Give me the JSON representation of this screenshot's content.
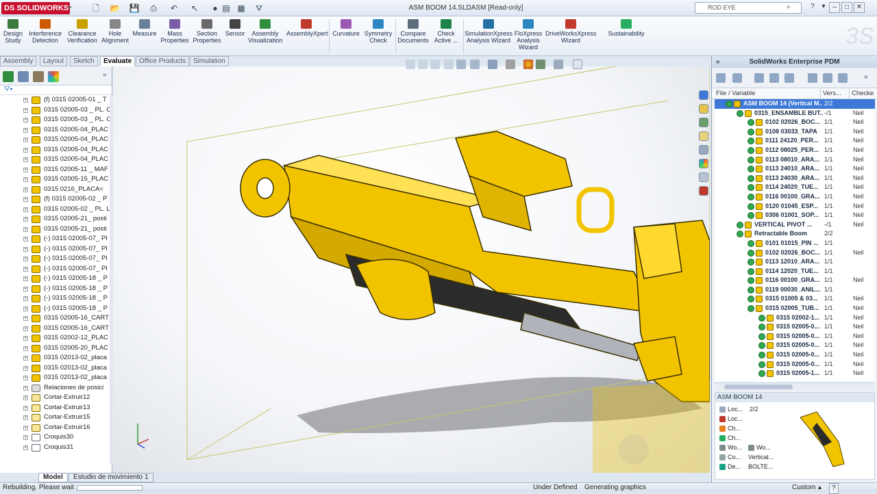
{
  "app": {
    "logo_text": "DS SOLIDWORKS",
    "document_title": "ASM BOOM 14.SLDASM [Read-only]"
  },
  "search": {
    "value": "ROD EYE"
  },
  "window_controls": [
    "?",
    "▾",
    "–",
    "□",
    "✕"
  ],
  "command_manager": {
    "items": [
      {
        "label": "Design\nStudy",
        "color": "#3a7a3a"
      },
      {
        "label": "Interference\nDetection",
        "color": "#d05a00"
      },
      {
        "label": "Clearance\nVerification",
        "color": "#c8a000"
      },
      {
        "label": "Hole\nAlignment",
        "color": "#888888"
      },
      {
        "label": "Measure",
        "color": "#6a7f99"
      },
      {
        "label": "Mass\nProperties",
        "color": "#7b5ea8"
      },
      {
        "label": "Section\nProperties",
        "color": "#6a6a6a"
      },
      {
        "label": "Sensor",
        "color": "#444444"
      },
      {
        "label": "Assembly\nVisualization",
        "color": "#2f8f3f"
      },
      {
        "label": "AssemblyXpert",
        "color": "#c0392b"
      },
      {
        "label": "Curvature",
        "color": "#9b59b6"
      },
      {
        "label": "Symmetry\nCheck",
        "color": "#2e86c1"
      },
      {
        "label": "Compare\nDocuments",
        "color": "#5d6d7e"
      },
      {
        "label": "Check\nActive ...",
        "color": "#1e8449"
      },
      {
        "label": "SimulationXpress\nAnalysis Wizard",
        "color": "#2471a3"
      },
      {
        "label": "FloXpress\nAnalysis\nWizard",
        "color": "#2e86c1"
      },
      {
        "label": "DriveWorksXpress\nWizard",
        "color": "#c0392b"
      },
      {
        "label": "Sustainability",
        "color": "#27ae60"
      }
    ]
  },
  "tabs": [
    {
      "label": "Assembly",
      "active": false
    },
    {
      "label": "Layout",
      "active": false
    },
    {
      "label": "Sketch",
      "active": false
    },
    {
      "label": "Evaluate",
      "active": true
    },
    {
      "label": "Office Products",
      "active": false
    },
    {
      "label": "Simulation",
      "active": false
    }
  ],
  "feature_tree": [
    {
      "label": "(f) 0315 02005-01 _ T",
      "type": "part"
    },
    {
      "label": "0315 02005-03 _ PL. C",
      "type": "part"
    },
    {
      "label": "0315 02005-03 _ PL. C",
      "type": "part"
    },
    {
      "label": "0315 02005-04_PLAC",
      "type": "part"
    },
    {
      "label": "0315 02005-04_PLAC",
      "type": "part"
    },
    {
      "label": "0315 02005-04_PLAC",
      "type": "part"
    },
    {
      "label": "0315 02005-04_PLAC",
      "type": "part"
    },
    {
      "label": "0315 02005-11 _ MAF",
      "type": "part"
    },
    {
      "label": "0315 02005-15_PLAC",
      "type": "part"
    },
    {
      "label": "0315 0216_PLACA<",
      "type": "part"
    },
    {
      "label": "(f) 0315 02005-02 _ P",
      "type": "part"
    },
    {
      "label": "0315 02005-02 _ PL. L",
      "type": "part"
    },
    {
      "label": "0315 02005-21_ posti",
      "type": "part"
    },
    {
      "label": "0315 02005-21_ posti",
      "type": "part"
    },
    {
      "label": "(-) 0315 02005-07_ PI",
      "type": "part"
    },
    {
      "label": "(-) 0315 02005-07_ PI",
      "type": "part"
    },
    {
      "label": "(-) 0315 02005-07_ PI",
      "type": "part"
    },
    {
      "label": "(-) 0315 02005-07_ PI",
      "type": "part"
    },
    {
      "label": "(-) 0315 02005-18 _ P",
      "type": "part"
    },
    {
      "label": "(-) 0315 02005-18 _ P",
      "type": "part"
    },
    {
      "label": "(-) 0315 02005-18 _ P",
      "type": "part"
    },
    {
      "label": "(-) 0315 02005-18 _ P",
      "type": "part"
    },
    {
      "label": "0315 02005-16_CART",
      "type": "part"
    },
    {
      "label": "0315 02005-16_CART",
      "type": "part"
    },
    {
      "label": "0315 02002-12_PLAC",
      "type": "part"
    },
    {
      "label": "0315 02005-20_PLAC",
      "type": "part"
    },
    {
      "label": "0315 02013-02_placa",
      "type": "part"
    },
    {
      "label": "0315 02013-02_placa",
      "type": "part"
    },
    {
      "label": "0315 02013-02_placa",
      "type": "part"
    },
    {
      "label": "Relaciones de posici",
      "type": "rel"
    },
    {
      "label": "Cortar-Extruir12",
      "type": "feat"
    },
    {
      "label": "Cortar-Extruir13",
      "type": "feat"
    },
    {
      "label": "Cortar-Extruir15",
      "type": "feat"
    },
    {
      "label": "Cortar-Extruir16",
      "type": "feat"
    },
    {
      "label": "Croquis30",
      "type": "sk"
    },
    {
      "label": "Croquis31",
      "type": "sk"
    }
  ],
  "bottom_tabs": [
    {
      "label": "Model",
      "active": true
    },
    {
      "label": "Estudio de movimiento 1",
      "active": false
    }
  ],
  "pdm": {
    "title": "SolidWorks Enterprise PDM",
    "columns": {
      "file": "File / Variable",
      "version": "Vers...",
      "checked": "Checke"
    },
    "rows": [
      {
        "name": "ASM BOOM 14  (Vertical M...",
        "version": "2/2",
        "checked": "",
        "level": 0,
        "selected": true
      },
      {
        "name": "0315_ENSAMBLE BUT...",
        "version": "-/1",
        "checked": "Neil",
        "level": 1
      },
      {
        "name": "0102 02026_BOC...",
        "version": "1/1",
        "checked": "Neil",
        "level": 2
      },
      {
        "name": "0108 03033_TAPA",
        "version": "1/1",
        "checked": "Neil",
        "level": 2
      },
      {
        "name": "0111 24120_PER...",
        "version": "1/1",
        "checked": "Neil",
        "level": 2
      },
      {
        "name": "0112 08025_PER...",
        "version": "1/1",
        "checked": "Neil",
        "level": 2
      },
      {
        "name": "0113 08010_ARA...",
        "version": "1/1",
        "checked": "Neil",
        "level": 2
      },
      {
        "name": "0113 24010_ARA...",
        "version": "1/1",
        "checked": "Neil",
        "level": 2
      },
      {
        "name": "0113 24030_ARA...",
        "version": "1/1",
        "checked": "Neil",
        "level": 2
      },
      {
        "name": "0114 24020_TUE...",
        "version": "1/1",
        "checked": "Neil",
        "level": 2
      },
      {
        "name": "0116 00100_GRA...",
        "version": "1/1",
        "checked": "Neil",
        "level": 2
      },
      {
        "name": "0120 01045_ESP...",
        "version": "1/1",
        "checked": "Neil",
        "level": 2
      },
      {
        "name": "0306 01001_SOP...",
        "version": "1/1",
        "checked": "Neil",
        "level": 2
      },
      {
        "name": "VERTICAL PIVOT ...",
        "version": "-/1",
        "checked": "Neil",
        "level": 1
      },
      {
        "name": "Retractable Boom",
        "version": "2/2",
        "checked": "",
        "level": 1
      },
      {
        "name": "0101 01015_PIN ...",
        "version": "1/1",
        "checked": "",
        "level": 2
      },
      {
        "name": "0102 02026_BOC...",
        "version": "1/1",
        "checked": "Neil",
        "level": 2
      },
      {
        "name": "0113 12010_ARA...",
        "version": "1/1",
        "checked": "",
        "level": 2
      },
      {
        "name": "0114 12020_TUE...",
        "version": "1/1",
        "checked": "",
        "level": 2
      },
      {
        "name": "0116 00100_GRA...",
        "version": "1/1",
        "checked": "Neil",
        "level": 2
      },
      {
        "name": "0119 00030_ANIL...",
        "version": "1/1",
        "checked": "",
        "level": 2
      },
      {
        "name": "0315 01005 & 03...",
        "version": "1/1",
        "checked": "Neil",
        "level": 2
      },
      {
        "name": "0315 02005_TUB...",
        "version": "1/1",
        "checked": "Neil",
        "level": 2
      },
      {
        "name": "0315 02002-1...",
        "version": "1/1",
        "checked": "Neil",
        "level": 3
      },
      {
        "name": "0315 02005-0...",
        "version": "1/1",
        "checked": "Neil",
        "level": 3
      },
      {
        "name": "0315 02005-0...",
        "version": "1/1",
        "checked": "Neil",
        "level": 3
      },
      {
        "name": "0315 02005-0...",
        "version": "1/1",
        "checked": "Neil",
        "level": 3
      },
      {
        "name": "0315 02005-0...",
        "version": "1/1",
        "checked": "Neil",
        "level": 3
      },
      {
        "name": "0315 02005-0...",
        "version": "1/1",
        "checked": "Neil",
        "level": 3
      },
      {
        "name": "0315 02005-1...",
        "version": "1/1",
        "checked": "Neil",
        "level": 3
      }
    ],
    "preview": {
      "title": "ASM BOOM 14",
      "rows": [
        {
          "col1": "Loc...",
          "col2": "2/2"
        },
        {
          "col1": "Loc...",
          "col2": ""
        },
        {
          "col1": "Ch...",
          "col2": ""
        },
        {
          "col1": "Ch...",
          "col2": ""
        },
        {
          "col1": "Wo...",
          "col2": "Wo..."
        },
        {
          "col1": "Co...",
          "col2": "Vertical..."
        },
        {
          "col1": "De...",
          "col2": "BOLTE..."
        }
      ]
    }
  },
  "status": {
    "left": "Rebuilding. Please wait ...",
    "under_defined": "Under Defined",
    "graphics": "Generating graphics",
    "units": "Custom",
    "help": "?"
  },
  "colors": {
    "part_yellow": "#f2c400",
    "selection_blue": "#3d78d8",
    "brand_red": "#c8102e"
  }
}
